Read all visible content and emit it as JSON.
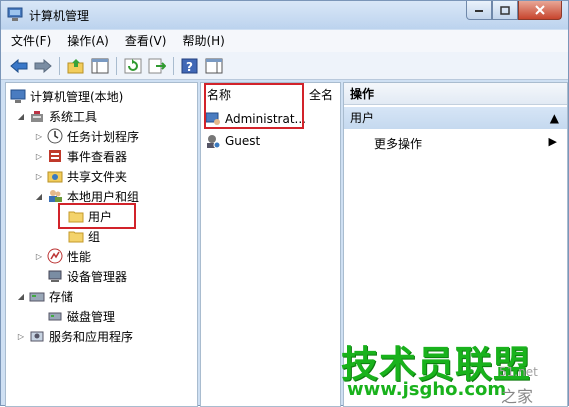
{
  "window": {
    "title": "计算机管理"
  },
  "menu": {
    "items": [
      "文件(F)",
      "操作(A)",
      "查看(V)",
      "帮助(H)"
    ]
  },
  "toolbar": {
    "icons": [
      "back-arrow",
      "forward-arrow",
      "up-folder",
      "show-hide-tree",
      "refresh",
      "export-list",
      "help",
      "show-hide-action-pane"
    ]
  },
  "tree": {
    "root": "计算机管理(本地)",
    "system_tools": "系统工具",
    "task_scheduler": "任务计划程序",
    "event_viewer": "事件查看器",
    "shared_folders": "共享文件夹",
    "local_users_groups": "本地用户和组",
    "users": "用户",
    "groups": "组",
    "performance": "性能",
    "device_manager": "设备管理器",
    "storage": "存储",
    "disk_management": "磁盘管理",
    "services_apps": "服务和应用程序"
  },
  "list": {
    "col_name": "名称",
    "col_fullname": "全名",
    "rows": [
      "Administrat...",
      "Guest"
    ]
  },
  "actions": {
    "header": "操作",
    "section": "用户",
    "item": "更多操作"
  },
  "watermark": {
    "brand": "技术员联盟",
    "url": "www.jsgho.com",
    "fragment": "51.net",
    "fragment2": "之家"
  },
  "colors": {
    "highlight_red": "#d2232a",
    "watermark_green": "#19b21c"
  }
}
